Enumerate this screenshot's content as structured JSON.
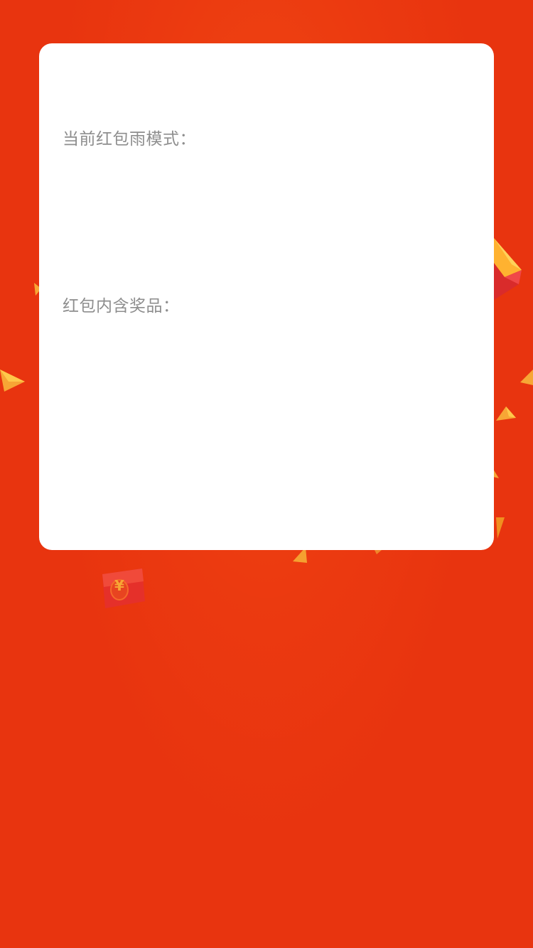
{
  "card": {
    "mode_label": "当前红包雨模式：",
    "prize_label": "红包内含奖品："
  },
  "background": {
    "primary_color": "#E8340F",
    "accent_colors": [
      "#FFB230",
      "#F08A20",
      "#D92B2B"
    ],
    "decorations": [
      "gold-ingot-icon",
      "gold-triangle-icon",
      "red-envelope-icon"
    ]
  },
  "envelope": {
    "glyph": "¥"
  }
}
